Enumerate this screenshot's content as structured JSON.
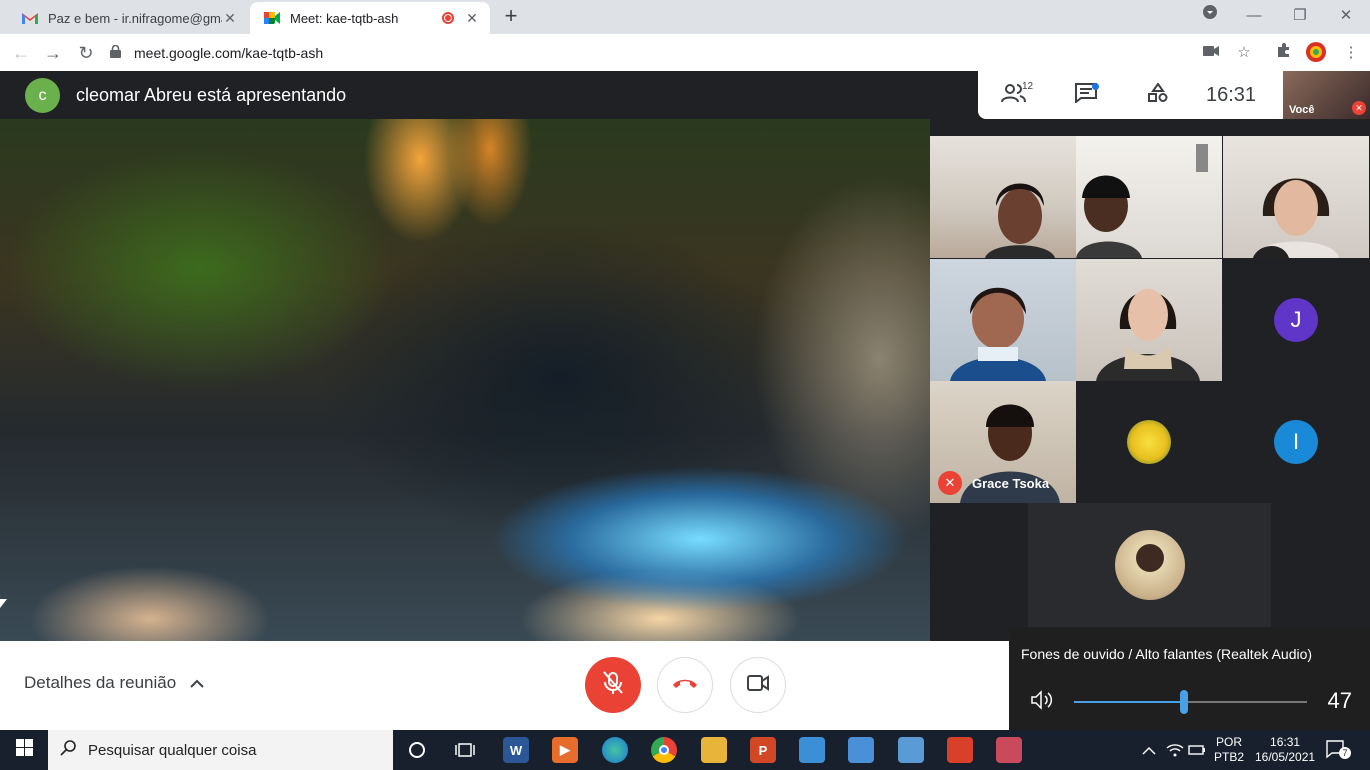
{
  "browser": {
    "tabs": [
      {
        "title": "Paz e bem - ir.nifragome@gmail.",
        "icon": "gmail-icon",
        "active": false
      },
      {
        "title": "Meet: kae-tqtb-ash",
        "icon": "meet-icon",
        "active": true,
        "recording": true
      }
    ],
    "new_tab_label": "+",
    "url": "meet.google.com/kae-tqtb-ash"
  },
  "meet": {
    "presenter_initial": "c",
    "presenter_text": "cleomar Abreu está apresentando",
    "participant_count": "12",
    "time": "16:31",
    "self_label": "Você",
    "participants": [
      {
        "type": "video"
      },
      {
        "type": "video"
      },
      {
        "type": "video"
      },
      {
        "type": "video"
      },
      {
        "type": "video"
      },
      {
        "type": "avatar",
        "initial": "J",
        "color": "#5f36c8"
      },
      {
        "type": "video",
        "name": "Grace Tsoka",
        "muted": true
      },
      {
        "type": "avatar-photo",
        "icon": "yellow-rose-icon"
      },
      {
        "type": "avatar",
        "initial": "I",
        "color": "#1a8ad8"
      },
      {
        "type": "avatar-photo",
        "icon": "profile-photo-icon"
      }
    ],
    "meeting_details_label": "Detalhes da reunião",
    "accent_red": "#ea4335"
  },
  "volume": {
    "device": "Fones de ouvido / Alto falantes (Realtek Audio)",
    "level": 47
  },
  "taskbar": {
    "search_placeholder": "Pesquisar qualquer coisa",
    "lang_top": "POR",
    "lang_bottom": "PTB2",
    "time": "16:31",
    "date": "16/05/2021",
    "notifications": "7"
  }
}
